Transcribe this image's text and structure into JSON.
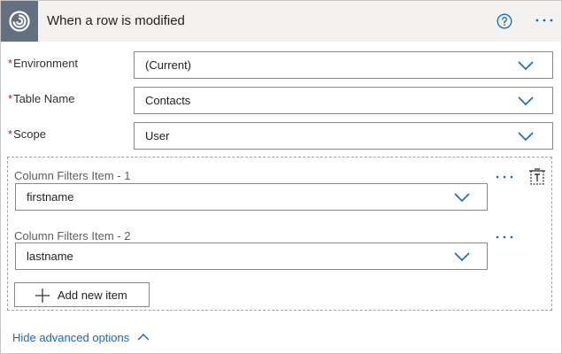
{
  "header": {
    "title": "When a row is modified",
    "connector_icon": "dataverse-icon",
    "help_icon": "help-circle-icon",
    "more_icon": "more-horizontal-icon"
  },
  "fields": {
    "environment": {
      "label": "Environment",
      "required_mark": "*",
      "value": "(Current)"
    },
    "table_name": {
      "label": "Table Name",
      "required_mark": "*",
      "value": "Contacts"
    },
    "scope": {
      "label": "Scope",
      "required_mark": "*",
      "value": "User"
    }
  },
  "column_filters": {
    "items": [
      {
        "label": "Column Filters Item - 1",
        "value": "firstname"
      },
      {
        "label": "Column Filters Item - 2",
        "value": "lastname"
      }
    ],
    "add_label": "Add new item"
  },
  "advanced": {
    "label": "Hide advanced options"
  },
  "colors": {
    "accent": "#0f6cbd",
    "required": "#a4262c",
    "header_bg": "#f3f2f1",
    "icon_bg": "#637080"
  }
}
